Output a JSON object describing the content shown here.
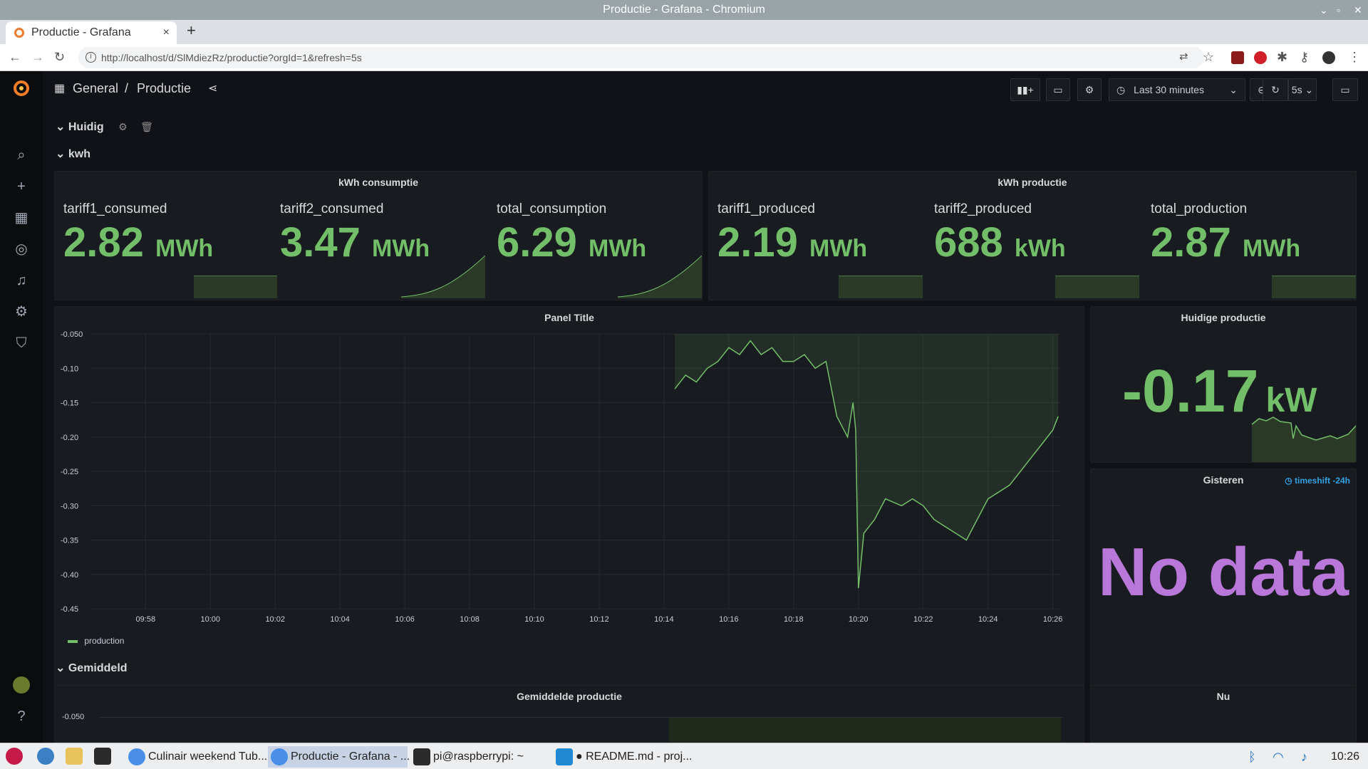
{
  "window": {
    "title": "Productie - Grafana - Chromium"
  },
  "browser": {
    "tab_title": "Productie - Grafana",
    "url": "http://localhost/d/SlMdiezRz/productie?orgId=1&refresh=5s"
  },
  "navbar": {
    "breadcrumb_folder": "General",
    "breadcrumb_sep": "/",
    "breadcrumb_title": "Productie",
    "time_range": "Last 30 minutes",
    "refresh_interval": "5s"
  },
  "rows": {
    "huidig": "Huidig",
    "kwh": "kwh",
    "gemiddeld": "Gemiddeld"
  },
  "consumption_panel": {
    "title": "kWh consumptie",
    "stats": [
      {
        "name": "tariff1_consumed",
        "value": "2.82",
        "unit": "MWh"
      },
      {
        "name": "tariff2_consumed",
        "value": "3.47",
        "unit": "MWh"
      },
      {
        "name": "total_consumption",
        "value": "6.29",
        "unit": "MWh"
      }
    ]
  },
  "production_panel": {
    "title": "kWh productie",
    "stats": [
      {
        "name": "tariff1_produced",
        "value": "2.19",
        "unit": "MWh"
      },
      {
        "name": "tariff2_produced",
        "value": "688",
        "unit": "kWh"
      },
      {
        "name": "total_production",
        "value": "2.87",
        "unit": "MWh"
      }
    ]
  },
  "graph_panel": {
    "title": "Panel Title",
    "legend": "production"
  },
  "current_panel": {
    "title": "Huidige productie",
    "value": "-0.17",
    "unit": "kW"
  },
  "yesterday_panel": {
    "title": "Gisteren",
    "timeshift": "timeshift -24h",
    "no_data": "No data"
  },
  "avg_panel": {
    "title": "Gemiddelde productie",
    "first_tick": "-0.050"
  },
  "now_panel": {
    "title": "Nu"
  },
  "chart_data": {
    "type": "line",
    "title": "Panel Title",
    "xlabel": "",
    "ylabel": "",
    "ylim": [
      -0.45,
      -0.05
    ],
    "y_ticks": [
      "-0.050",
      "-0.10",
      "-0.15",
      "-0.20",
      "-0.25",
      "-0.30",
      "-0.35",
      "-0.40",
      "-0.45"
    ],
    "x_ticks": [
      "09:58",
      "10:00",
      "10:02",
      "10:04",
      "10:06",
      "10:08",
      "10:10",
      "10:12",
      "10:14",
      "10:16",
      "10:18",
      "10:20",
      "10:22",
      "10:24",
      "10:26"
    ],
    "legend": "top-left-below",
    "series": [
      {
        "name": "production",
        "color": "#73bf69",
        "points": [
          [
            "10:14:20",
            -0.13
          ],
          [
            "10:14:40",
            -0.11
          ],
          [
            "10:15:00",
            -0.12
          ],
          [
            "10:15:20",
            -0.1
          ],
          [
            "10:15:40",
            -0.09
          ],
          [
            "10:16:00",
            -0.07
          ],
          [
            "10:16:20",
            -0.08
          ],
          [
            "10:16:40",
            -0.06
          ],
          [
            "10:17:00",
            -0.08
          ],
          [
            "10:17:20",
            -0.07
          ],
          [
            "10:17:40",
            -0.09
          ],
          [
            "10:18:00",
            -0.09
          ],
          [
            "10:18:20",
            -0.08
          ],
          [
            "10:18:40",
            -0.1
          ],
          [
            "10:19:00",
            -0.09
          ],
          [
            "10:19:20",
            -0.17
          ],
          [
            "10:19:40",
            -0.2
          ],
          [
            "10:19:50",
            -0.15
          ],
          [
            "10:19:55",
            -0.19
          ],
          [
            "10:20:00",
            -0.42
          ],
          [
            "10:20:10",
            -0.34
          ],
          [
            "10:20:30",
            -0.32
          ],
          [
            "10:20:50",
            -0.29
          ],
          [
            "10:21:20",
            -0.3
          ],
          [
            "10:21:40",
            -0.29
          ],
          [
            "10:22:00",
            -0.3
          ],
          [
            "10:22:20",
            -0.32
          ],
          [
            "10:22:40",
            -0.33
          ],
          [
            "10:23:00",
            -0.34
          ],
          [
            "10:23:20",
            -0.35
          ],
          [
            "10:23:40",
            -0.32
          ],
          [
            "10:24:00",
            -0.29
          ],
          [
            "10:24:20",
            -0.28
          ],
          [
            "10:24:40",
            -0.27
          ],
          [
            "10:25:00",
            -0.25
          ],
          [
            "10:25:20",
            -0.23
          ],
          [
            "10:25:40",
            -0.21
          ],
          [
            "10:26:00",
            -0.19
          ],
          [
            "10:26:10",
            -0.17
          ]
        ]
      }
    ]
  },
  "taskbar": {
    "items": [
      "Culinair weekend Tub...",
      "Productie - Grafana - ...",
      "pi@raspberrypi: ~",
      "● README.md - proj..."
    ],
    "clock": "10:26"
  },
  "colors": {
    "green": "#73bf69",
    "purple": "#b877d9",
    "bg": "#111217",
    "panel": "#181b1f"
  }
}
